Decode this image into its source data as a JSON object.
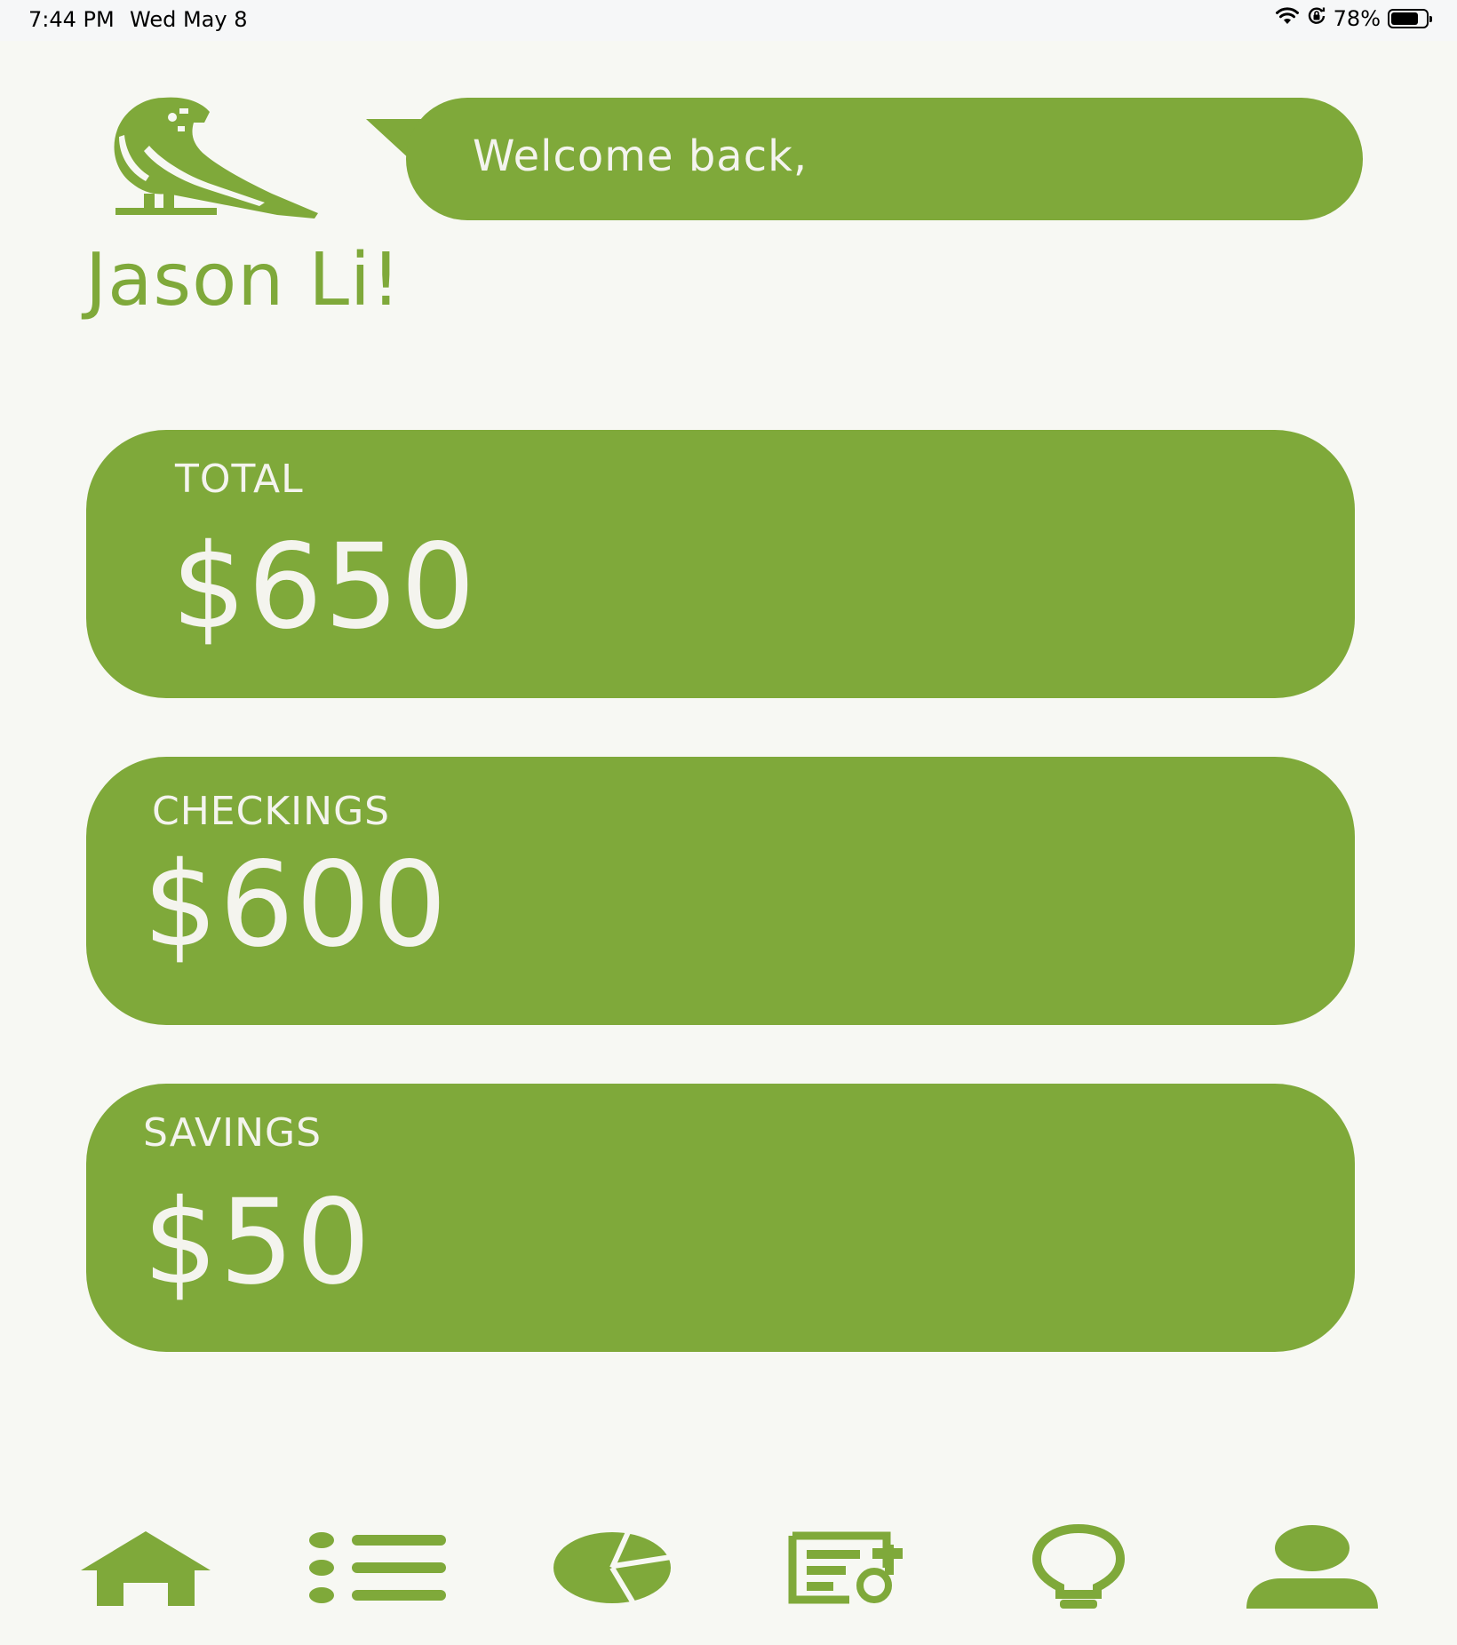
{
  "status_bar": {
    "time": "7:44 PM",
    "date": "Wed May 8",
    "battery_percent": "78%",
    "battery_level": 0.78,
    "icons": [
      "wifi-icon",
      "orientation-lock-icon",
      "battery-icon"
    ]
  },
  "header": {
    "logo_icon": "parrot-logo-icon",
    "greeting": "Welcome back,",
    "user_name": "Jason Li!"
  },
  "balances": [
    {
      "label": "TOTAL",
      "amount": "$650"
    },
    {
      "label": "CHECKINGS",
      "amount": "$600"
    },
    {
      "label": "SAVINGS",
      "amount": "$50"
    }
  ],
  "nav": {
    "items": [
      {
        "icon": "home-icon"
      },
      {
        "icon": "list-icon"
      },
      {
        "icon": "pie-chart-icon"
      },
      {
        "icon": "news-icon"
      },
      {
        "icon": "lightbulb-icon"
      },
      {
        "icon": "profile-icon"
      }
    ]
  },
  "colors": {
    "accent": "#7fa93a",
    "background": "#f7f8f3",
    "card_text": "#f4f4ee"
  }
}
